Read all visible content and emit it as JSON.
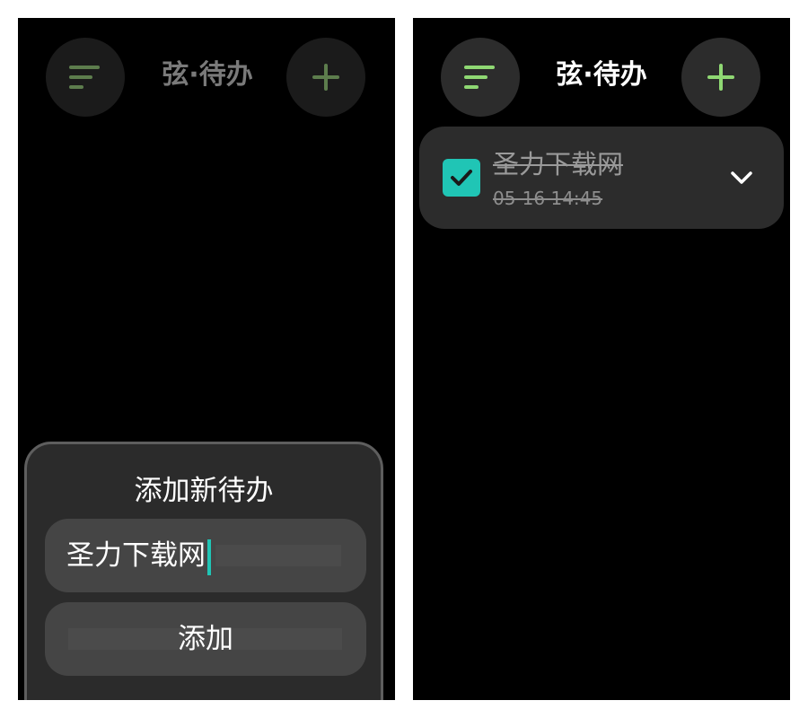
{
  "left_screen": {
    "header": {
      "title": "弦·待办",
      "menu_icon": "sort-lines-icon",
      "add_icon": "plus-icon"
    },
    "add_sheet": {
      "title": "添加新待办",
      "input_value": "圣力下载网",
      "submit_label": "添加"
    }
  },
  "right_screen": {
    "header": {
      "title": "弦·待办",
      "menu_icon": "sort-lines-icon",
      "add_icon": "plus-icon"
    },
    "todos": [
      {
        "title": "圣力下载网",
        "time": "05-16 14:45",
        "completed": true,
        "expand_icon": "chevron-down-icon"
      }
    ]
  },
  "colors": {
    "accent_green": "#8fd873",
    "checkbox_teal": "#20c5b5",
    "surface": "#2c2c2c",
    "background": "#000000"
  }
}
